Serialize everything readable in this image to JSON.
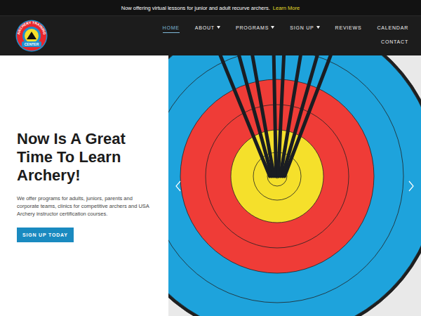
{
  "announcement": {
    "text": "Now offering virtual lessons for junior and adult recurve archers.",
    "link": "Learn More"
  },
  "logo": {
    "top": "ARCHERY TRAINING",
    "bottom": "CENTER"
  },
  "nav": [
    {
      "label": "HOME",
      "selected": true,
      "dropdown": false
    },
    {
      "label": "ABOUT",
      "selected": false,
      "dropdown": true
    },
    {
      "label": "PROGRAMS",
      "selected": false,
      "dropdown": true
    },
    {
      "label": "SIGN UP",
      "selected": false,
      "dropdown": true
    },
    {
      "label": "REVIEWS",
      "selected": false,
      "dropdown": false
    },
    {
      "label": "CALENDAR",
      "selected": false,
      "dropdown": false
    },
    {
      "label": "CONTACT",
      "selected": false,
      "dropdown": false
    }
  ],
  "hero": {
    "title": "Now Is A Great Time To Learn Archery!",
    "text": "We offer programs for adults, juniors, parents and corporate teams, clinics for competitive archers and USA Archery instructor certification courses.",
    "button": "SIGN UP TODAY"
  }
}
